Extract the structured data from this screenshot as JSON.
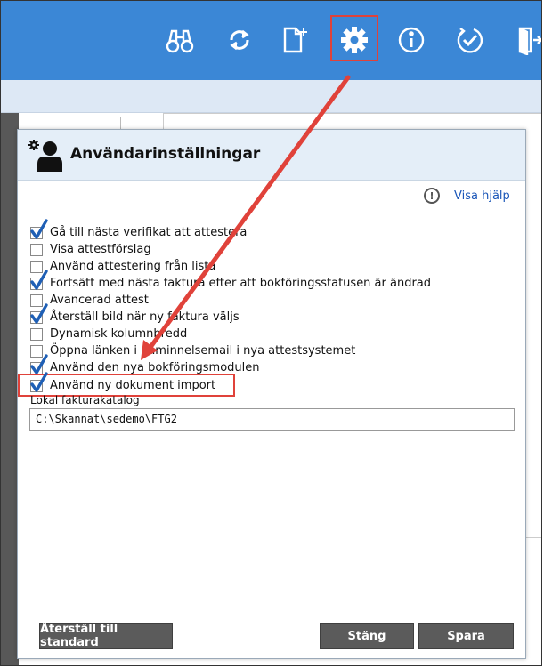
{
  "toolbar": {
    "icons": [
      "binoculars-icon",
      "sync-icon",
      "new-document-icon",
      "gear-icon",
      "info-icon",
      "attest-check-icon",
      "logout-icon"
    ]
  },
  "dialog": {
    "title": "Användarinställningar",
    "help_link": "Visa hjälp",
    "help_icon": "!",
    "options": [
      {
        "label": "Gå till nästa verifikat att attestera",
        "checked": true
      },
      {
        "label": "Visa attestförslag",
        "checked": false
      },
      {
        "label": "Använd attestering från lista",
        "checked": false
      },
      {
        "label": "Fortsätt med nästa faktura efter att bokföringsstatusen är ändrad",
        "checked": true
      },
      {
        "label": "Avancerad attest",
        "checked": false
      },
      {
        "label": "Återställ bild när ny faktura väljs",
        "checked": true
      },
      {
        "label": "Dynamisk kolumnbredd",
        "checked": false
      },
      {
        "label": "Öppna länken i påminnelsemail i nya attestsystemet",
        "checked": false
      },
      {
        "label": "Använd den nya bokföringsmodulen",
        "checked": true
      },
      {
        "label": "Använd ny dokument import",
        "checked": true
      }
    ],
    "catalog_label": "Lokal fakturakatalog",
    "catalog_value": "C:\\Skannat\\sedemo\\FTG2",
    "buttons": {
      "reset": "Återställ till standard",
      "close": "Stäng",
      "save": "Spara"
    }
  },
  "colors": {
    "toolbar": "#3b87d6",
    "annotation": "#e0423a",
    "button": "#5b5b5b",
    "link": "#1a56b8"
  }
}
